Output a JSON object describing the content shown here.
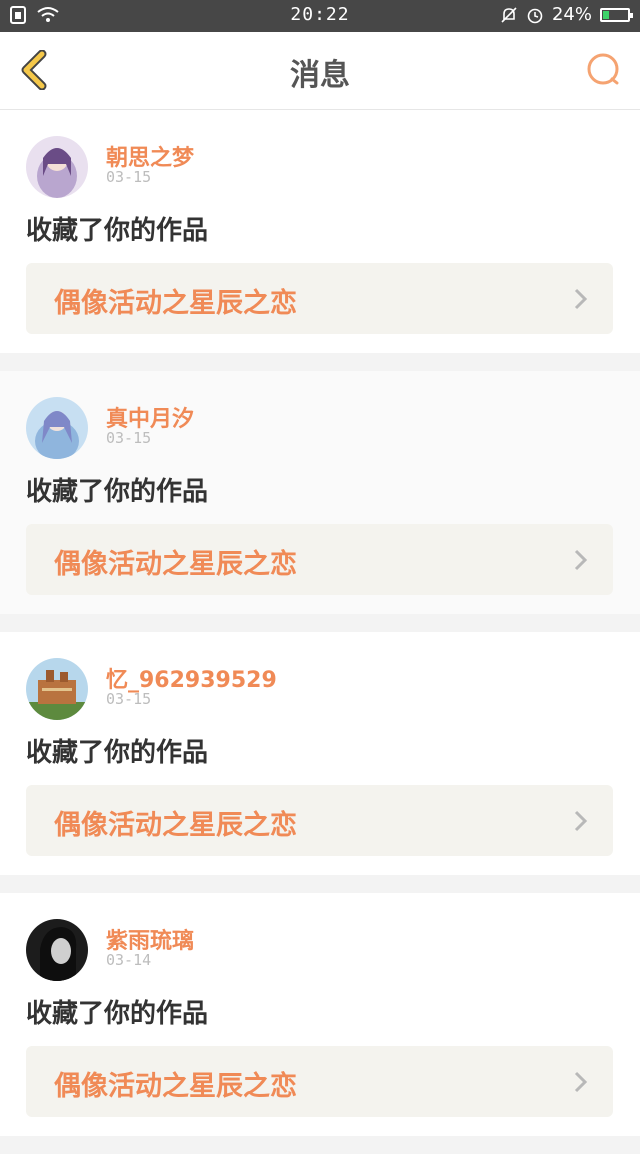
{
  "status_bar": {
    "time": "20:22",
    "battery": "24%",
    "battery_level": 0.24
  },
  "header": {
    "title": "消息",
    "back_icon": "chevron-left-icon",
    "search_icon": "search-icon"
  },
  "accent_color": "#f08a56",
  "messages": [
    {
      "user": "朝思之梦",
      "date": "03-15",
      "action": "收藏了你的作品",
      "work_title": "偶像活动之星辰之恋"
    },
    {
      "user": "真中月汐",
      "date": "03-15",
      "action": "收藏了你的作品",
      "work_title": "偶像活动之星辰之恋"
    },
    {
      "user": "忆_962939529",
      "date": "03-15",
      "action": "收藏了你的作品",
      "work_title": "偶像活动之星辰之恋"
    },
    {
      "user": "紫雨琉璃",
      "date": "03-14",
      "action": "收藏了你的作品",
      "work_title": "偶像活动之星辰之恋"
    }
  ]
}
